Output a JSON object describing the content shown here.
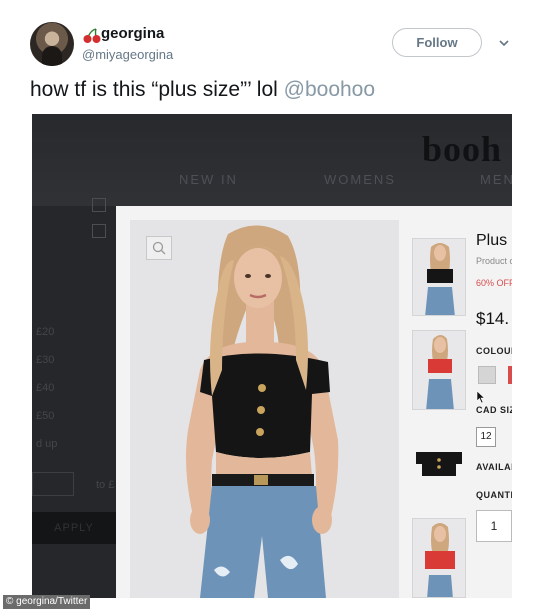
{
  "tweet": {
    "display_name": "georgina",
    "handle": "@miyageorgina",
    "follow_label": "Follow",
    "text": "how tf is this “plus size”’ lol ",
    "mention": "@boohoo",
    "name_emoji_icon": "cherries-icon"
  },
  "photo": {
    "site_logo": "booh",
    "nav": [
      "NEW IN",
      "WOMENS",
      "MEN"
    ],
    "filter_labels": [
      "£20",
      "£30",
      "£40",
      "£50",
      "d up",
      "to £"
    ],
    "apply_label": "APPLY",
    "product": {
      "title": "Plus",
      "code": "Product c",
      "discount": "60% OFF",
      "price": "$14.",
      "colour_label": "COLOUR",
      "size_label": "CAD SIZ",
      "size_value": "12",
      "availability_label": "AVAILAB",
      "quantity_label": "QUANTI",
      "quantity_value": "1"
    }
  },
  "credit": "© georgina/Twitter",
  "colors": {
    "accent_red": "#d94c4c",
    "top_black": "#111111",
    "denim": "#6e93b8",
    "hair": "#cfa77e"
  }
}
